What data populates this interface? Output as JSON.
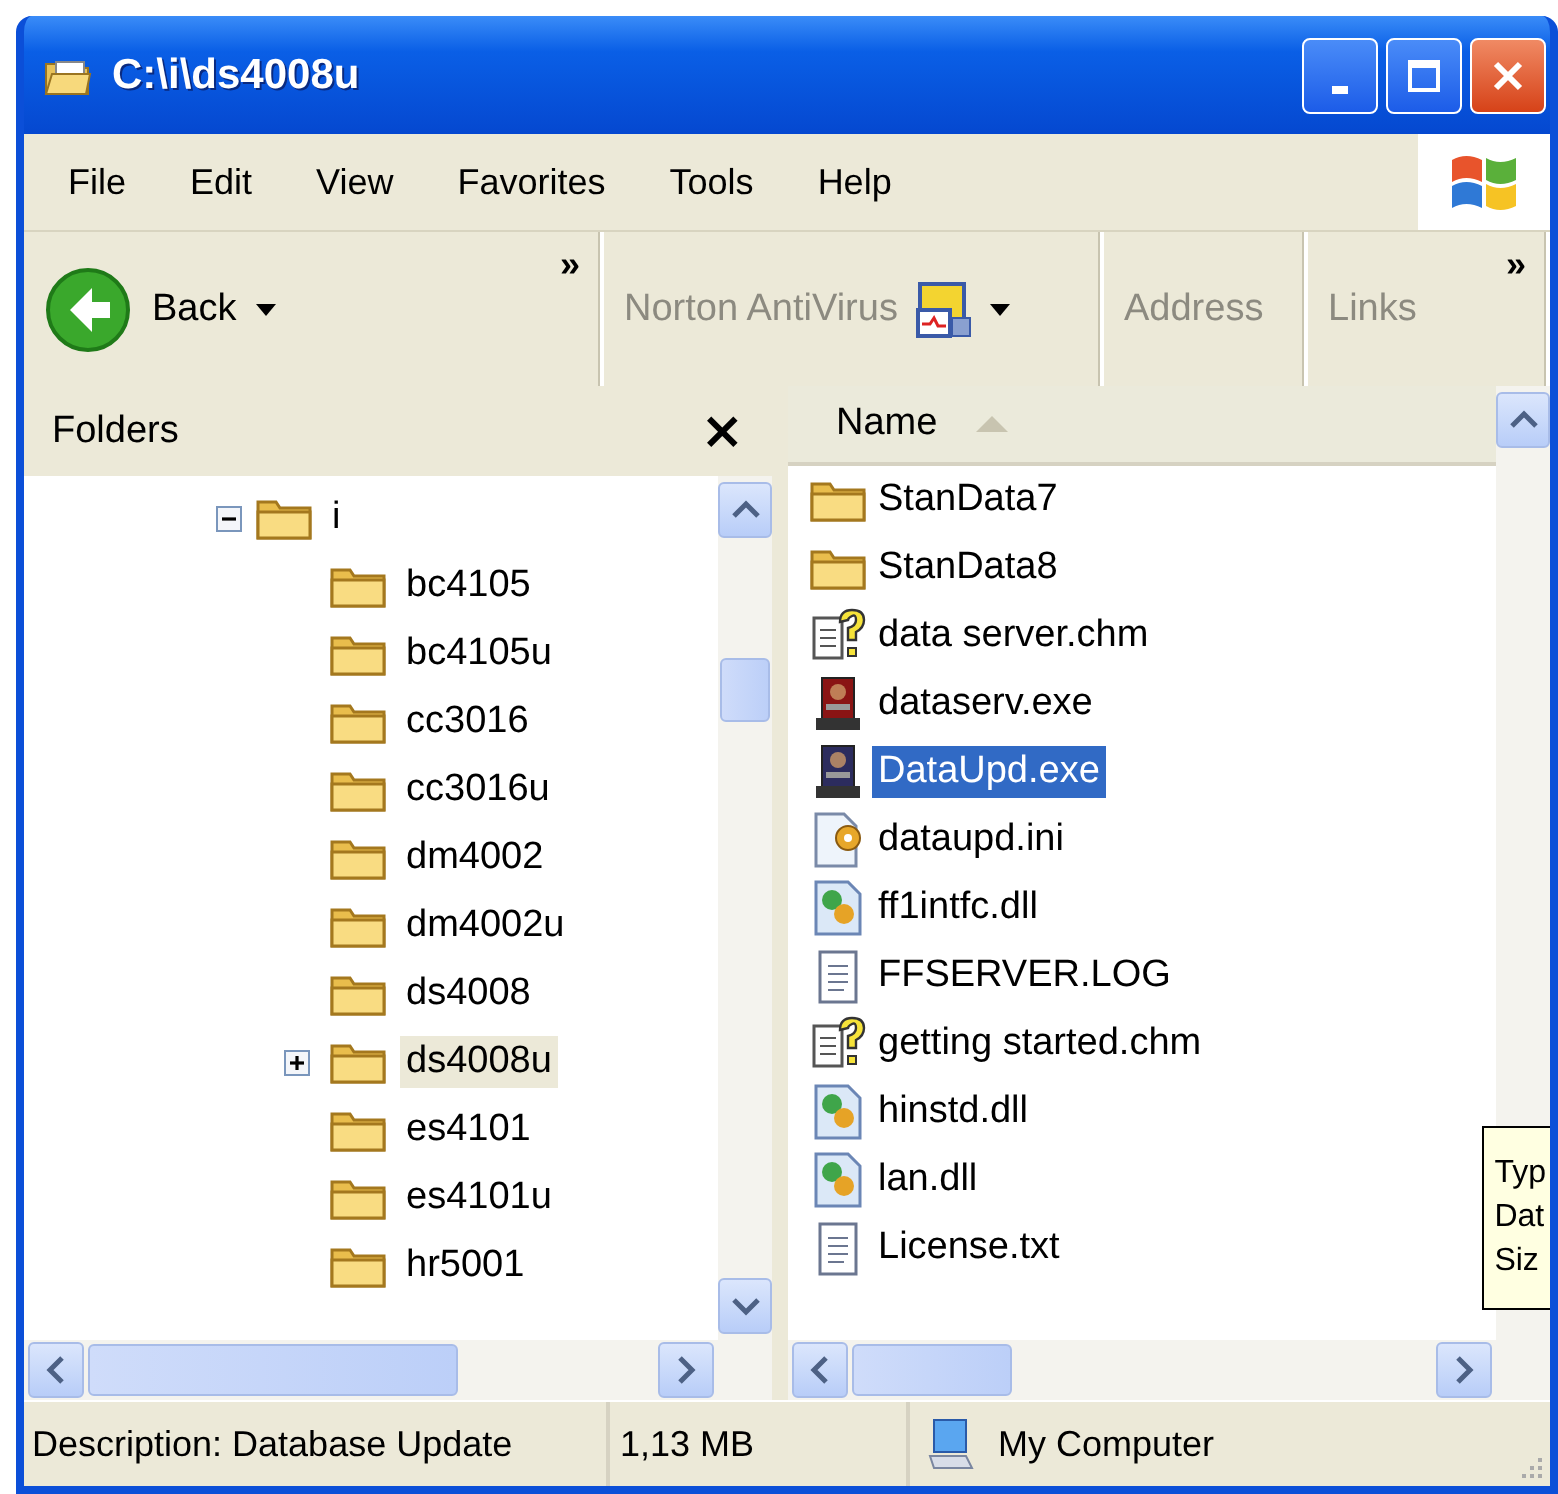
{
  "window": {
    "title": "C:\\i\\ds4008u"
  },
  "menu": [
    "File",
    "Edit",
    "View",
    "Favorites",
    "Tools",
    "Help"
  ],
  "toolbar": {
    "back": "Back",
    "chevron": "»",
    "norton": "Norton AntiVirus",
    "address": "Address",
    "links": "Links",
    "links_chevron": "»"
  },
  "folders_pane": {
    "title": "Folders",
    "close": "×",
    "tree": [
      {
        "label": "i",
        "expanded": true,
        "selected": false,
        "children": [
          {
            "label": "bc4105",
            "selected": false
          },
          {
            "label": "bc4105u",
            "selected": false
          },
          {
            "label": "cc3016",
            "selected": false
          },
          {
            "label": "cc3016u",
            "selected": false
          },
          {
            "label": "dm4002",
            "selected": false
          },
          {
            "label": "dm4002u",
            "selected": false
          },
          {
            "label": "ds4008",
            "selected": false
          },
          {
            "label": "ds4008u",
            "expanded": false,
            "selected": true
          },
          {
            "label": "es4101",
            "selected": false
          },
          {
            "label": "es4101u",
            "selected": false
          },
          {
            "label": "hr5001",
            "selected": false
          }
        ]
      }
    ]
  },
  "file_list": {
    "columns": [
      "Name"
    ],
    "files": [
      {
        "name": "StanData7",
        "kind": "folder",
        "selected": false
      },
      {
        "name": "StanData8",
        "kind": "folder",
        "selected": false
      },
      {
        "name": "data server.chm",
        "kind": "help",
        "selected": false
      },
      {
        "name": "dataserv.exe",
        "kind": "server",
        "selected": false
      },
      {
        "name": "DataUpd.exe",
        "kind": "updater",
        "selected": true
      },
      {
        "name": "dataupd.ini",
        "kind": "settings",
        "selected": false
      },
      {
        "name": "ff1intfc.dll",
        "kind": "library",
        "selected": false
      },
      {
        "name": "FFSERVER.LOG",
        "kind": "text",
        "selected": false
      },
      {
        "name": "getting started.chm",
        "kind": "help",
        "selected": false
      },
      {
        "name": "hinstd.dll",
        "kind": "library",
        "selected": false
      },
      {
        "name": "lan.dll",
        "kind": "library",
        "selected": false
      },
      {
        "name": "License.txt",
        "kind": "text",
        "selected": false
      }
    ]
  },
  "tooltip": {
    "lines": [
      "Typ",
      "Dat",
      "Siz"
    ]
  },
  "status_bar": {
    "description": "Description: Database Update",
    "size": "1,13 MB",
    "zone": "My Computer"
  }
}
